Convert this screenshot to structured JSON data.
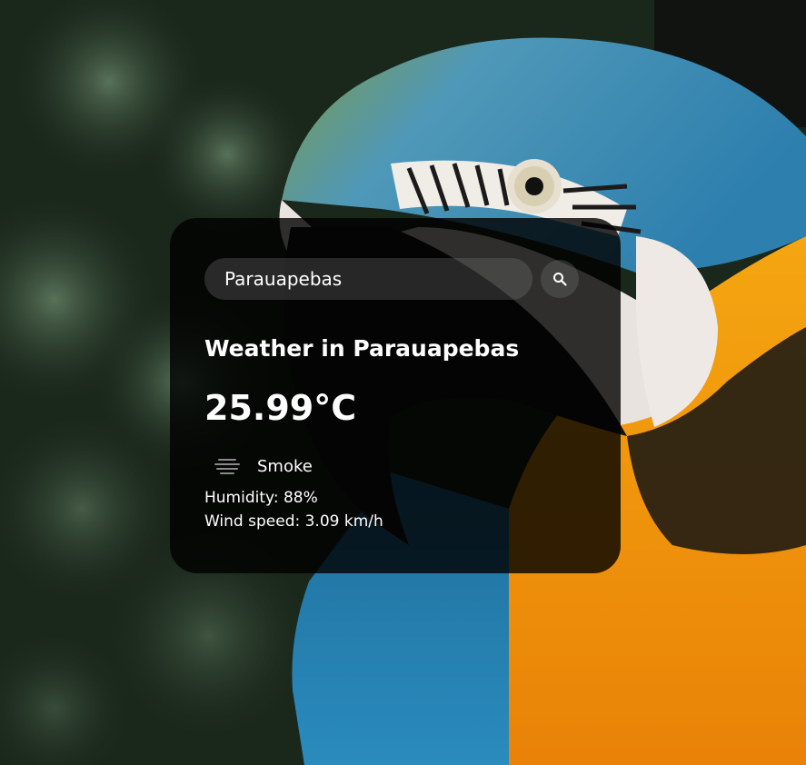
{
  "search": {
    "value": "Parauapebas"
  },
  "weather": {
    "heading": "Weather in Parauapebas",
    "temperature": "25.99°C",
    "description": "Smoke",
    "humidity": "Humidity: 88%",
    "wind": "Wind speed: 3.09 km/h"
  },
  "icons": {
    "search": "search-icon",
    "condition": "smoke-haze-icon"
  },
  "colors": {
    "card_background": "rgba(0,0,0,0.8)",
    "input_background": "rgba(124,124,124,0.3)",
    "text": "#ffffff"
  }
}
